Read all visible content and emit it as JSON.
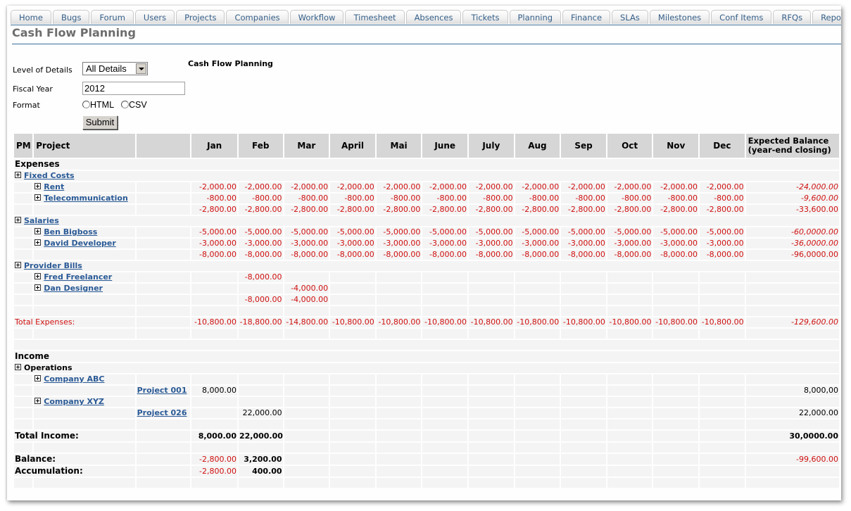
{
  "nav": {
    "tabs": [
      "Home",
      "Bugs",
      "Forum",
      "Users",
      "Projects",
      "Companies",
      "Workflow",
      "Timesheet",
      "Absences",
      "Tickets",
      "Planning",
      "Finance",
      "SLAs",
      "Milestones",
      "Conf Items",
      "RFQs",
      "Reports"
    ]
  },
  "page": {
    "title": "Cash Flow Planning",
    "report_title": "Cash Flow Planning"
  },
  "form": {
    "level_label": "Level of Details",
    "level_value": "All Details",
    "fiscal_label": "Fiscal Year",
    "fiscal_value": "2012",
    "format_label": "Format",
    "format_options": [
      "HTML",
      "CSV"
    ],
    "submit_label": "Submit"
  },
  "colors": {
    "negative": "#d01010",
    "link": "#2a5a96",
    "header_bg": "#d6d6d6",
    "cell_bg": "#f4f4f4",
    "rule": "#3b6e98"
  },
  "table": {
    "headers": {
      "pm": "PM",
      "project": "Project",
      "months": [
        "Jan",
        "Feb",
        "Mar",
        "April",
        "Mai",
        "June",
        "July",
        "Aug",
        "Sep",
        "Oct",
        "Nov",
        "Dec"
      ],
      "expected_line1": "Expected Balance",
      "expected_line2": "(year-end closing)"
    },
    "expenses_label": "Expenses",
    "fixed_costs": {
      "label": "Fixed Costs",
      "rent": {
        "label": "Rent",
        "monthly": "-2,000.00",
        "total": "-24,000.00"
      },
      "telecom": {
        "label": "Telecommunication",
        "monthly": "-800.00",
        "total": "-9,600.00"
      },
      "subtotal": {
        "monthly": "-2,800.00",
        "total": "-33,600.00"
      }
    },
    "salaries": {
      "label": "Salaries",
      "ben": {
        "label": "Ben Bigboss",
        "monthly": "-5,000.00",
        "total": "-60,0000.00"
      },
      "david": {
        "label": "David Developer",
        "monthly": "-3,000.00",
        "total": "-36,0000.00"
      },
      "subtotal": {
        "monthly": "-8,000.00",
        "total": "-96,0000.00"
      }
    },
    "provider_bills": {
      "label": "Provider Bills",
      "fred": {
        "label": "Fred Freelancer",
        "feb": "-8,000.00"
      },
      "dan": {
        "label": "Dan Designer",
        "mar": "-4,000.00"
      },
      "subtotal": {
        "feb": "-8,000.00",
        "mar": "-4,000.00"
      }
    },
    "total_expenses": {
      "label": "Total Expenses:",
      "months": [
        "-10,800.00",
        "-18,800.00",
        "-14,800.00",
        "-10,800.00",
        "-10,800.00",
        "-10,800.00",
        "-10,800.00",
        "-10,800.00",
        "-10,800.00",
        "-10,800.00",
        "-10,800.00",
        "-10,800.00"
      ],
      "total": "-129,600.00"
    },
    "income_label": "Income",
    "operations_label": "Operations",
    "company_abc": {
      "label": "Company ABC",
      "project": "Project 001",
      "jan": "8,000.00",
      "total": "8,000,00"
    },
    "company_xyz": {
      "label": "Company XYZ",
      "project": "Project 026",
      "feb": "22,000.00",
      "total": "22,000.00"
    },
    "total_income": {
      "label": "Total Income:",
      "jan": "8,000.00",
      "feb": "22,000.00",
      "total": "30,0000.00"
    },
    "balance": {
      "label": "Balance:",
      "jan": "-2,800.00",
      "feb": "3,200.00",
      "total": "-99,600.00"
    },
    "accumulation": {
      "label": "Accumulation:",
      "jan": "-2,800.00",
      "feb": "400.00"
    }
  }
}
